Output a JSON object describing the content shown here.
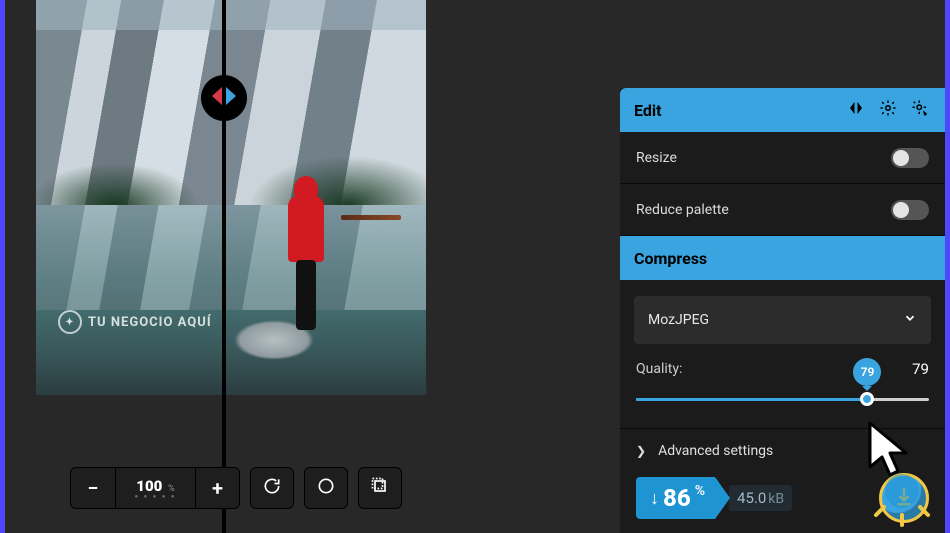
{
  "watermark_text": "TU NEGOCIO AQUÍ",
  "zoom": {
    "minus": "−",
    "value": "100",
    "unit": "%",
    "plus": "+"
  },
  "panel": {
    "edit_title": "Edit",
    "resize_label": "Resize",
    "reduce_palette_label": "Reduce palette",
    "compress_title": "Compress",
    "encoder": "MozJPEG",
    "quality_label": "Quality:",
    "quality_value": "79",
    "quality_tooltip": "79",
    "advanced_label": "Advanced settings",
    "savings_pct": "86",
    "savings_unit": "%",
    "size_value": "45.0",
    "size_unit": "kB"
  },
  "colors": {
    "accent": "#3aa4e0"
  }
}
